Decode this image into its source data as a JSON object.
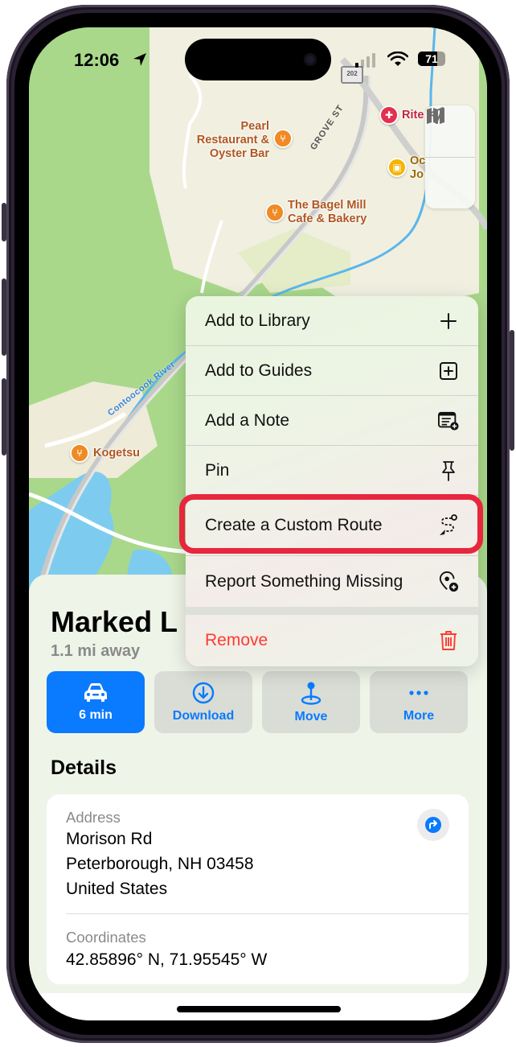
{
  "status_bar": {
    "time": "12:06",
    "battery_percent": "71",
    "battery_level": 0.71,
    "signal_bars_active": 1,
    "signal_bars_total": 4
  },
  "map": {
    "highway_shield": "202",
    "street_labels": [
      "GROVE ST"
    ],
    "river_label": "Contoocook River",
    "pois": [
      {
        "name": "Pearl Restaurant & Oyster Bar",
        "lines": [
          "Pearl",
          "Restaurant &",
          "Oyster Bar"
        ],
        "category": "restaurant",
        "color": "#f08a24"
      },
      {
        "name": "The Bagel Mill Cafe & Bakery",
        "lines": [
          "The Bagel Mill",
          "Cafe & Bakery"
        ],
        "category": "restaurant",
        "color": "#f08a24"
      },
      {
        "name": "Rite",
        "lines": [
          "Rite"
        ],
        "category": "pharmacy",
        "color": "#e3304f"
      },
      {
        "name": "Oc... Jo...",
        "lines": [
          "Oc",
          "Jo"
        ],
        "category": "shopping",
        "color": "#f5b400"
      },
      {
        "name": "Kogetsu",
        "lines": [
          "Kogetsu"
        ],
        "category": "restaurant",
        "color": "#f08a24"
      }
    ],
    "controls": [
      {
        "id": "map-mode",
        "icon": "map-icon"
      },
      {
        "id": "locate",
        "icon": "location-arrow-icon"
      }
    ]
  },
  "context_menu": {
    "items": [
      {
        "label": "Add to Library",
        "icon": "plus-icon"
      },
      {
        "label": "Add to Guides",
        "icon": "plus-square-icon"
      },
      {
        "label": "Add a Note",
        "icon": "note-add-icon"
      },
      {
        "label": "Pin",
        "icon": "pin-icon"
      },
      {
        "label": "Create a Custom Route",
        "icon": "custom-route-icon",
        "highlighted": true
      },
      {
        "label": "Report Something Missing",
        "icon": "report-missing-icon"
      },
      {
        "label": "Remove",
        "icon": "trash-icon",
        "destructive": true
      }
    ],
    "highlight_color": "#e8263e",
    "destructive_color": "#ff3b30"
  },
  "place_card": {
    "title": "Marked L",
    "distance": "1.1 mi away",
    "actions": [
      {
        "label": "6 min",
        "icon": "car-icon",
        "primary": true
      },
      {
        "label": "Download",
        "icon": "download-icon"
      },
      {
        "label": "Move",
        "icon": "move-pin-icon"
      },
      {
        "label": "More",
        "icon": "ellipsis-icon"
      }
    ],
    "accent_color": "#0a7aff",
    "details_heading": "Details",
    "address_label": "Address",
    "address_lines": [
      "Morison Rd",
      "Peterborough, NH  03458",
      "United States"
    ],
    "coordinates_label": "Coordinates",
    "coordinates": "42.85896° N, 71.95545° W"
  }
}
